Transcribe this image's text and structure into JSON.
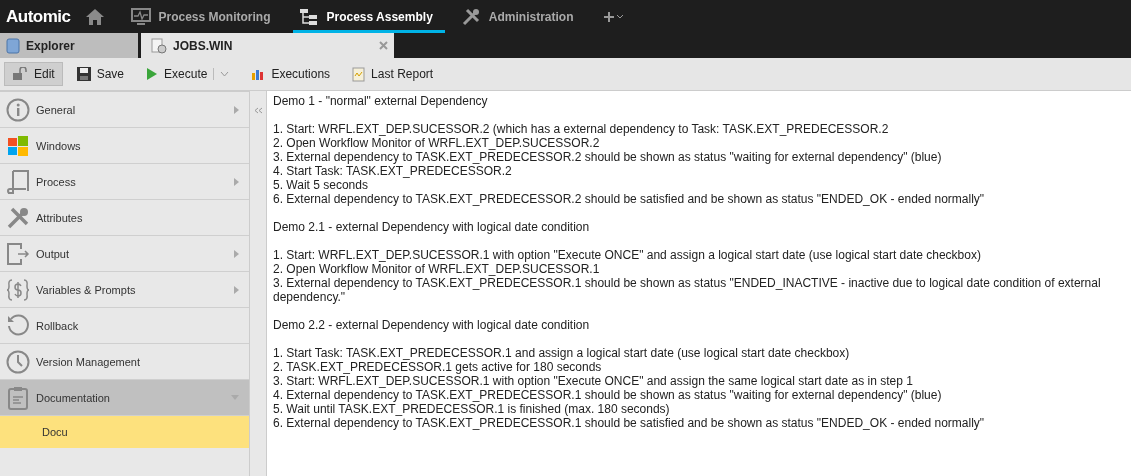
{
  "brand": "Automic",
  "nav": [
    {
      "label": "Process Monitoring",
      "selected": false
    },
    {
      "label": "Process Assembly",
      "selected": true
    },
    {
      "label": "Administration",
      "selected": false
    }
  ],
  "editor_tabs": [
    {
      "label": "Explorer",
      "selected": false,
      "closable": false
    },
    {
      "label": "JOBS.WIN",
      "selected": true,
      "closable": true
    }
  ],
  "toolbar": [
    {
      "label": "Edit",
      "pressed": true,
      "dropdown": false
    },
    {
      "label": "Save",
      "pressed": false,
      "dropdown": false
    },
    {
      "label": "Execute",
      "pressed": false,
      "dropdown": true
    },
    {
      "label": "Executions",
      "pressed": false,
      "dropdown": false
    },
    {
      "label": "Last Report",
      "pressed": false,
      "dropdown": false
    }
  ],
  "sidebar": {
    "items": [
      {
        "label": "General",
        "submenu": true,
        "expanded": false,
        "selected": false
      },
      {
        "label": "Windows",
        "submenu": false,
        "selected": false
      },
      {
        "label": "Process",
        "submenu": true,
        "expanded": false,
        "selected": false
      },
      {
        "label": "Attributes",
        "submenu": false,
        "selected": false
      },
      {
        "label": "Output",
        "submenu": true,
        "expanded": false,
        "selected": false
      },
      {
        "label": "Variables & Prompts",
        "submenu": true,
        "expanded": false,
        "selected": false
      },
      {
        "label": "Rollback",
        "submenu": false,
        "selected": false
      },
      {
        "label": "Version Management",
        "submenu": false,
        "selected": false
      },
      {
        "label": "Documentation",
        "submenu": true,
        "expanded": true,
        "selected": true,
        "children": [
          {
            "label": "Docu",
            "selected": true
          }
        ]
      }
    ]
  },
  "document": {
    "sections": [
      {
        "title": "Demo 1 - \"normal\" external Dependency",
        "steps": [
          "1. Start: WRFL.EXT_DEP.SUCESSOR.2 (which has a external dependency to Task: TASK.EXT_PREDECESSOR.2",
          "2. Open Workflow Monitor of WRFL.EXT_DEP.SUCESSOR.2",
          "3. External dependency to TASK.EXT_PREDECESSOR.2 should be shown as status \"waiting for external dependency\" (blue)",
          "4. Start Task: TASK.EXT_PREDECESSOR.2",
          "5. Wait 5 seconds",
          "6. External dependency to TASK.EXT_PREDECESSOR.2 should be satisfied and be shown as status \"ENDED_OK - ended normally\""
        ]
      },
      {
        "title": "Demo 2.1 - external Dependency with logical date condition",
        "steps": [
          "1. Start: WRFL.EXT_DEP.SUCESSOR.1 with option \"Execute ONCE\" and assign a logical start date (use logical start date checkbox)",
          "2. Open Workflow Monitor of WRFL.EXT_DEP.SUCESSOR.1",
          "3. External dependency to TASK.EXT_PREDECESSOR.1 should be shown as status \"ENDED_INACTIVE - inactive due to logical date condition of external dependency.\""
        ]
      },
      {
        "title": "Demo 2.2 - external Dependency with logical date condition",
        "steps": [
          "1. Start Task: TASK.EXT_PREDECESSOR.1 and assign a logical start date (use logical start date checkbox)",
          "2. TASK.EXT_PREDECESSOR.1 gets active for 180 seconds",
          "3. Start: WRFL.EXT_DEP.SUCESSOR.1 with option \"Execute ONCE\" and assign the same logical start date as in step 1",
          "4.  External dependency to TASK.EXT_PREDECESSOR.1 should be shown as status \"waiting for external dependency\" (blue)",
          "5. Wait until TASK.EXT_PREDECESSOR.1 is finished (max. 180 seconds)",
          "6. External dependency to TASK.EXT_PREDECESSOR.1 should be satisfied and be shown as status \"ENDED_OK - ended normally\""
        ]
      }
    ]
  }
}
